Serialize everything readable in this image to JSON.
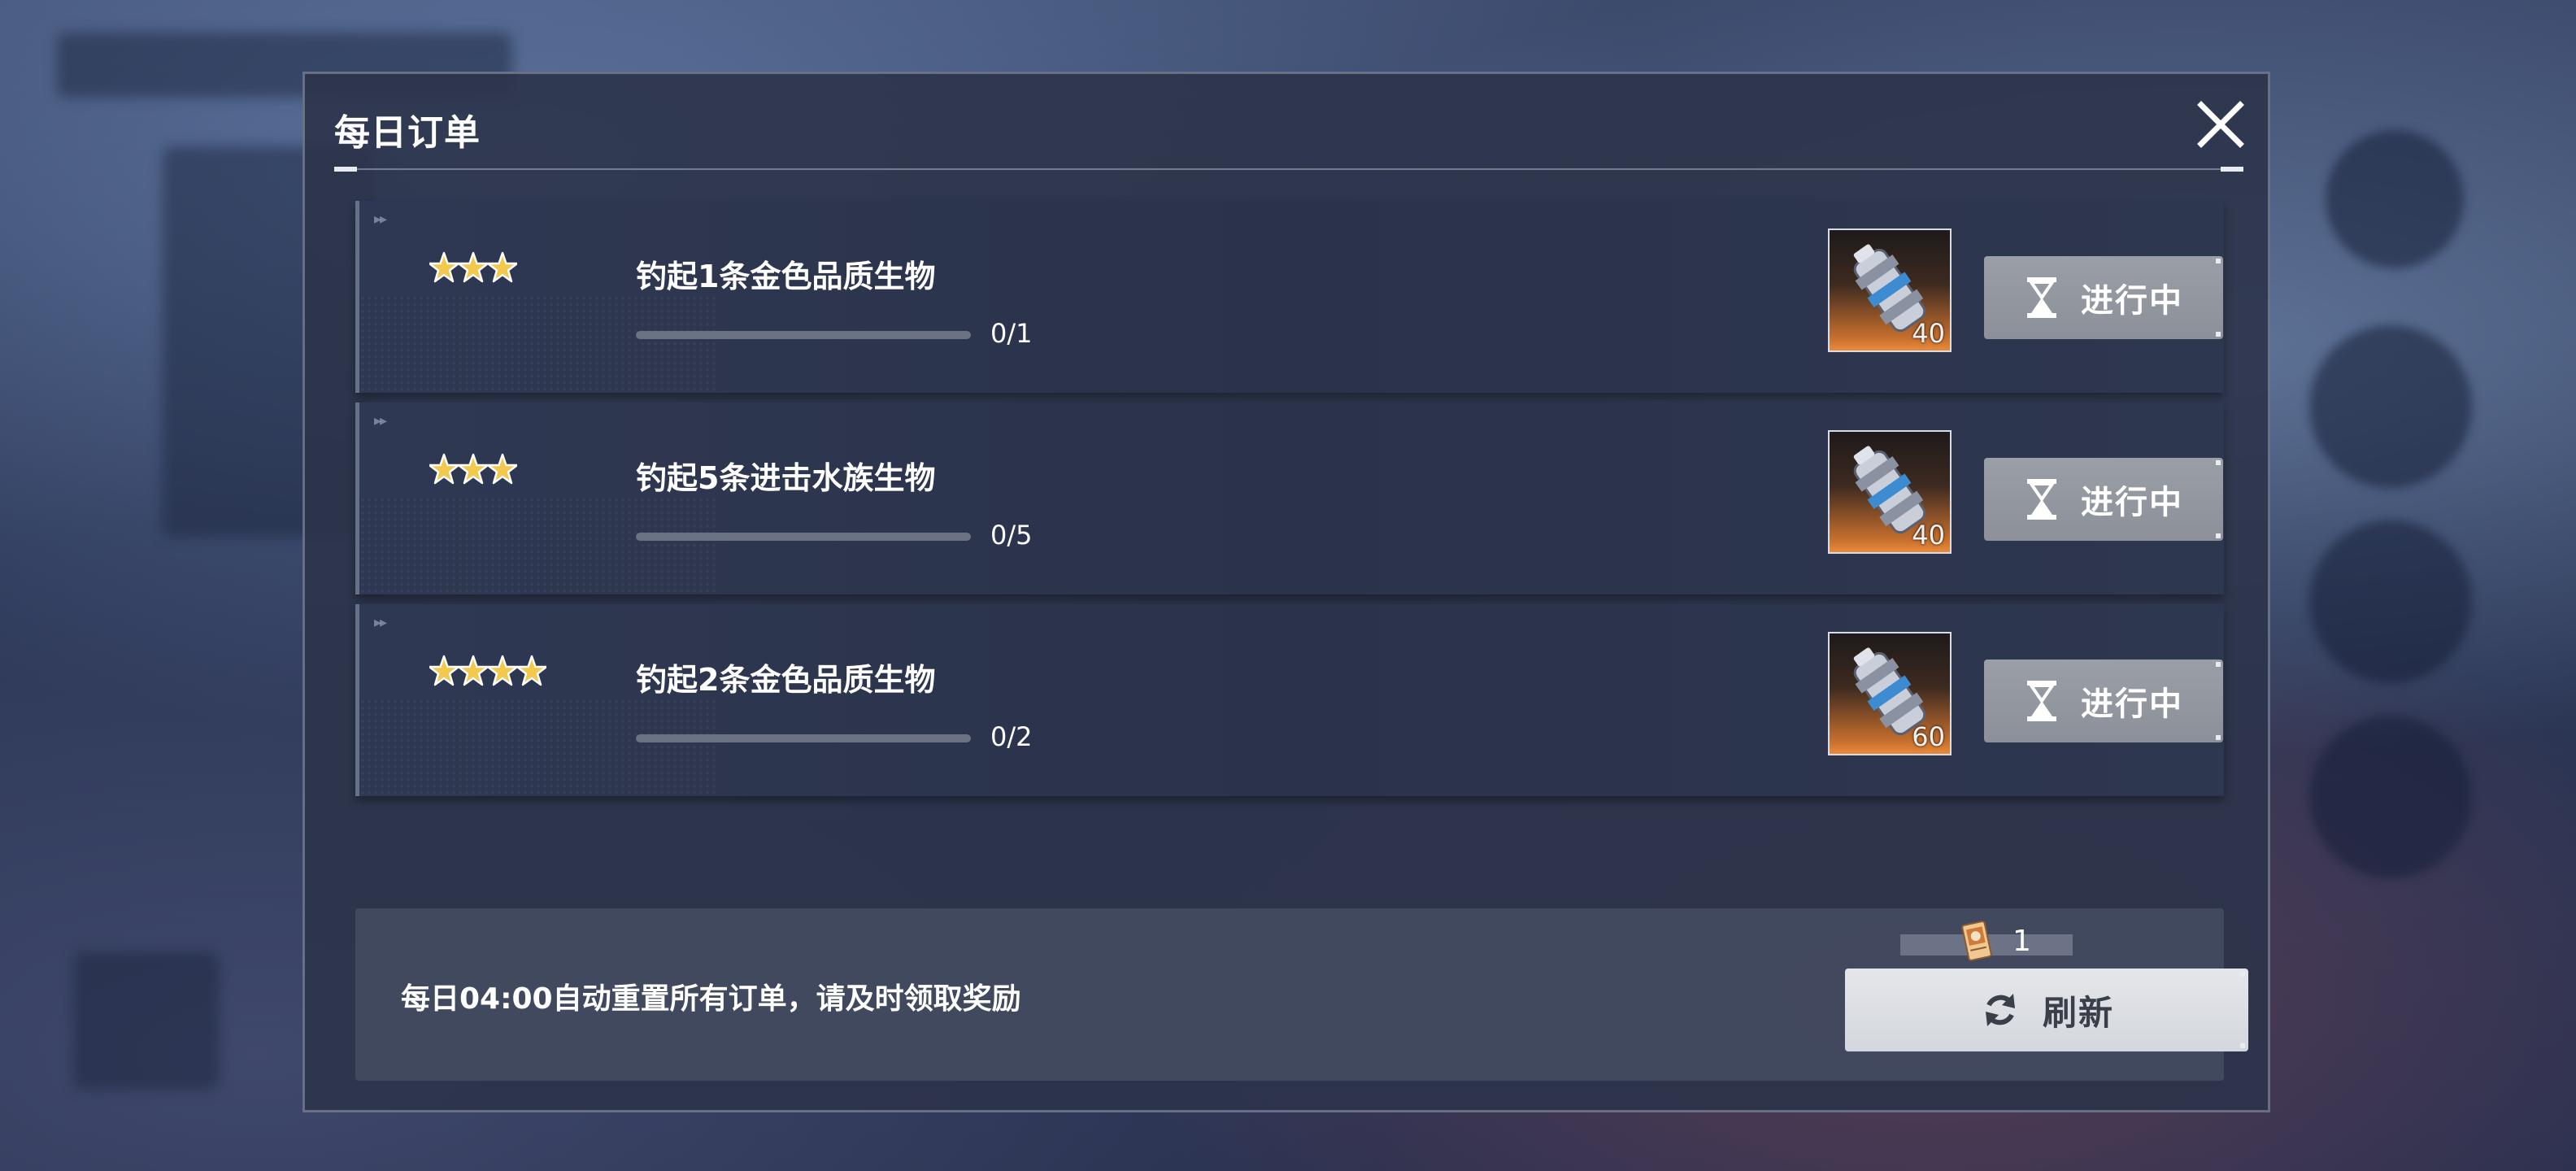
{
  "dialog": {
    "title": "每日订单",
    "close_icon": "close-icon"
  },
  "orders": [
    {
      "stars": 3,
      "task": "钓起1条金色品质生物",
      "progress_text": "0/1",
      "progress_fraction": 0,
      "reward_count": "40",
      "reward_icon": "canister-icon",
      "status": "进行中",
      "status_icon": "hourglass-icon"
    },
    {
      "stars": 3,
      "task": "钓起5条进击水族生物",
      "progress_text": "0/5",
      "progress_fraction": 0,
      "reward_count": "40",
      "reward_icon": "canister-icon",
      "status": "进行中",
      "status_icon": "hourglass-icon"
    },
    {
      "stars": 4,
      "task": "钓起2条金色品质生物",
      "progress_text": "0/2",
      "progress_fraction": 0,
      "reward_count": "60",
      "reward_icon": "canister-icon",
      "status": "进行中",
      "status_icon": "hourglass-icon"
    }
  ],
  "footer": {
    "notice": "每日04:00自动重置所有订单，请及时领取奖励",
    "refresh_cost": "1",
    "refresh_cost_icon": "ticket-icon",
    "refresh_label": "刷新",
    "refresh_icon": "refresh-icon"
  },
  "colors": {
    "panel": "#2c344a",
    "star": "#f2c94c",
    "button_gray": "#8c9099",
    "button_light": "#dcdfe4"
  }
}
